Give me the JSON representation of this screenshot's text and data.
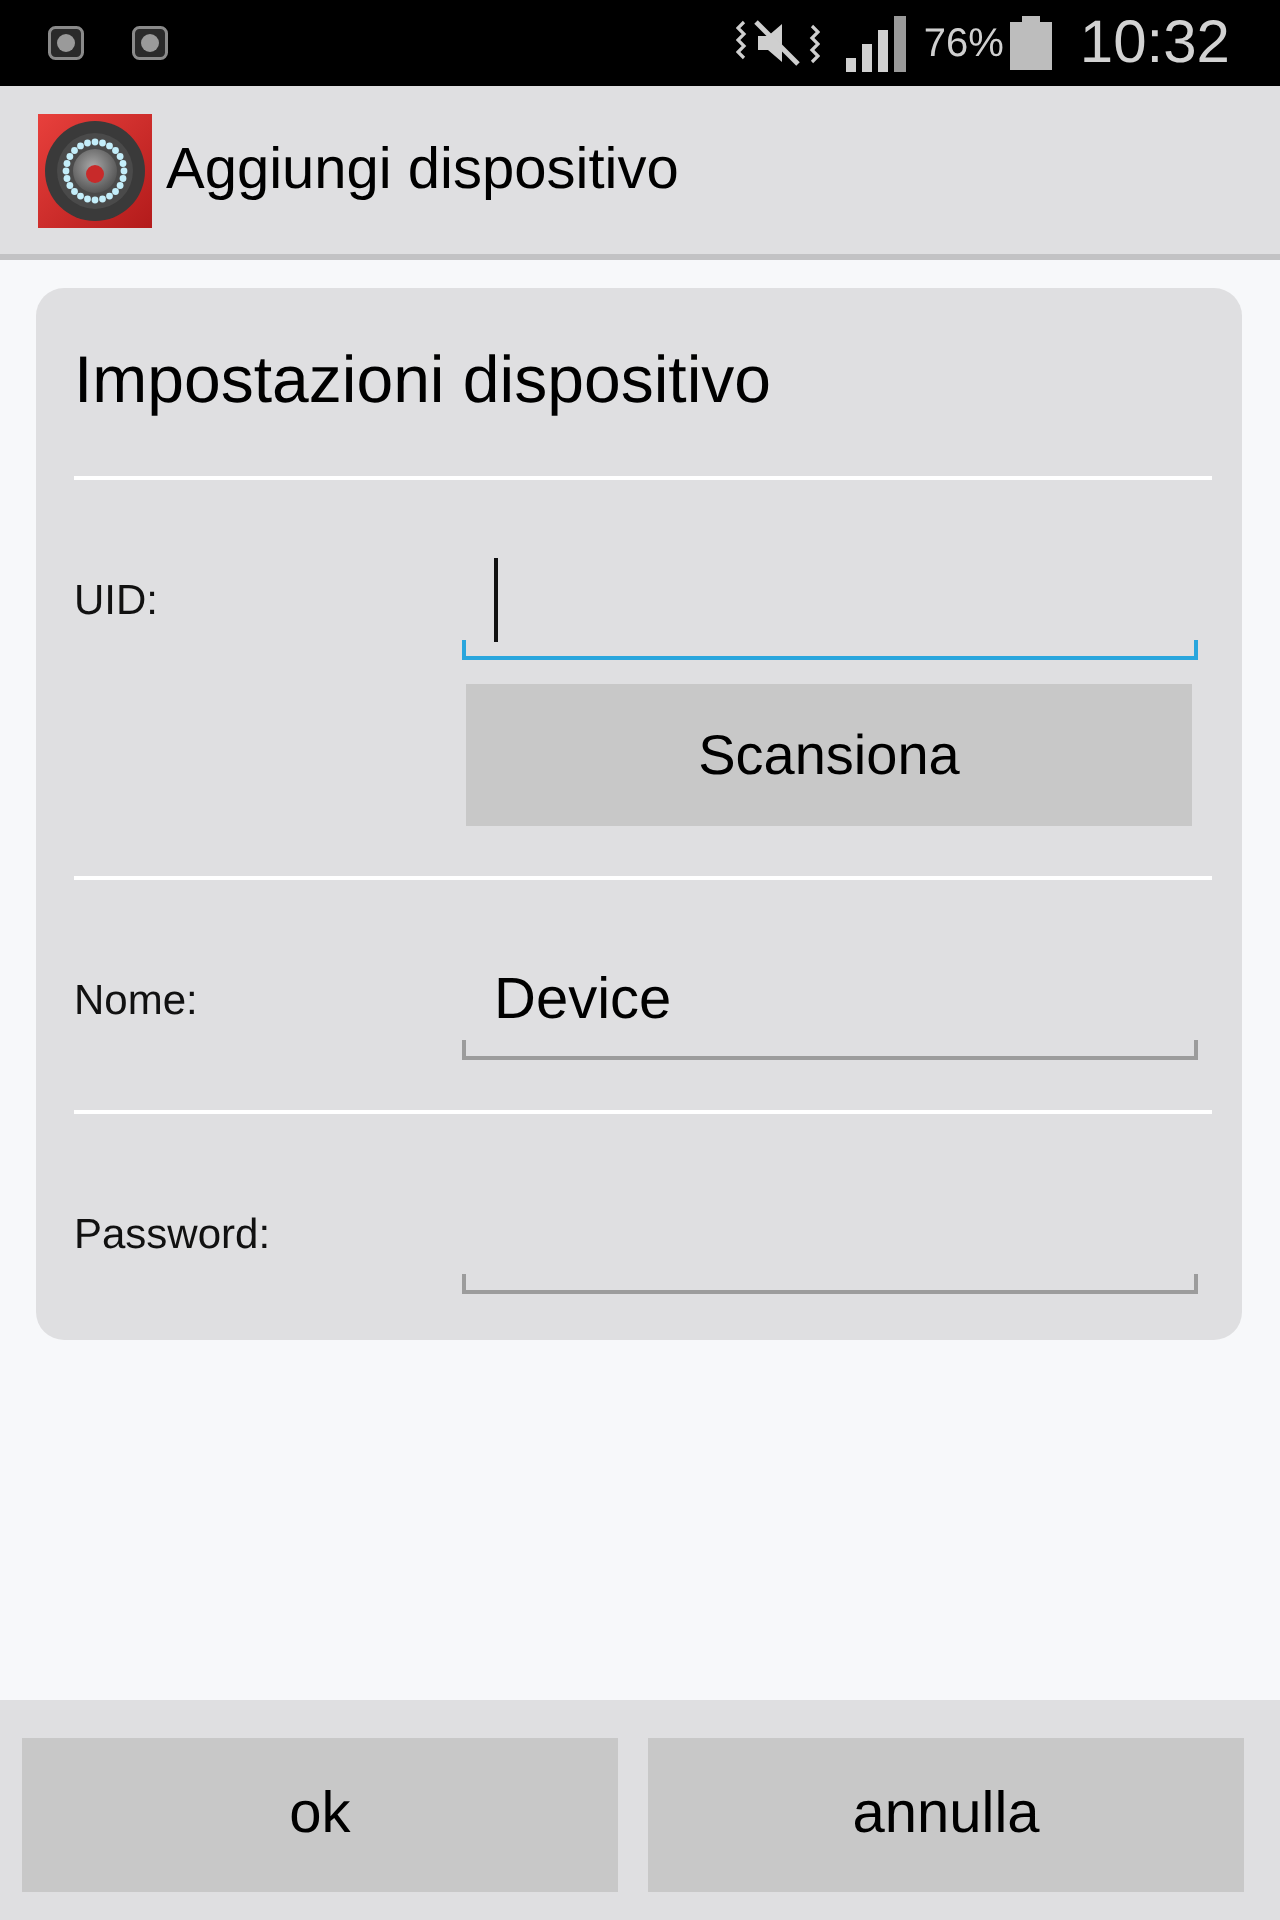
{
  "status_bar": {
    "battery_percent": "76%",
    "time": "10:32"
  },
  "action_bar": {
    "title": "Aggiungi dispositivo"
  },
  "card": {
    "title": "Impostazioni dispositivo",
    "fields": [
      {
        "label": "UID:",
        "focused": true,
        "button": "Scansiona"
      },
      {
        "label": "Nome:",
        "focused": false,
        "value": "Device"
      },
      {
        "label": "Password:",
        "focused": false
      }
    ]
  },
  "buttons": [
    {
      "label": "ok"
    },
    {
      "label": "annulla"
    }
  ]
}
